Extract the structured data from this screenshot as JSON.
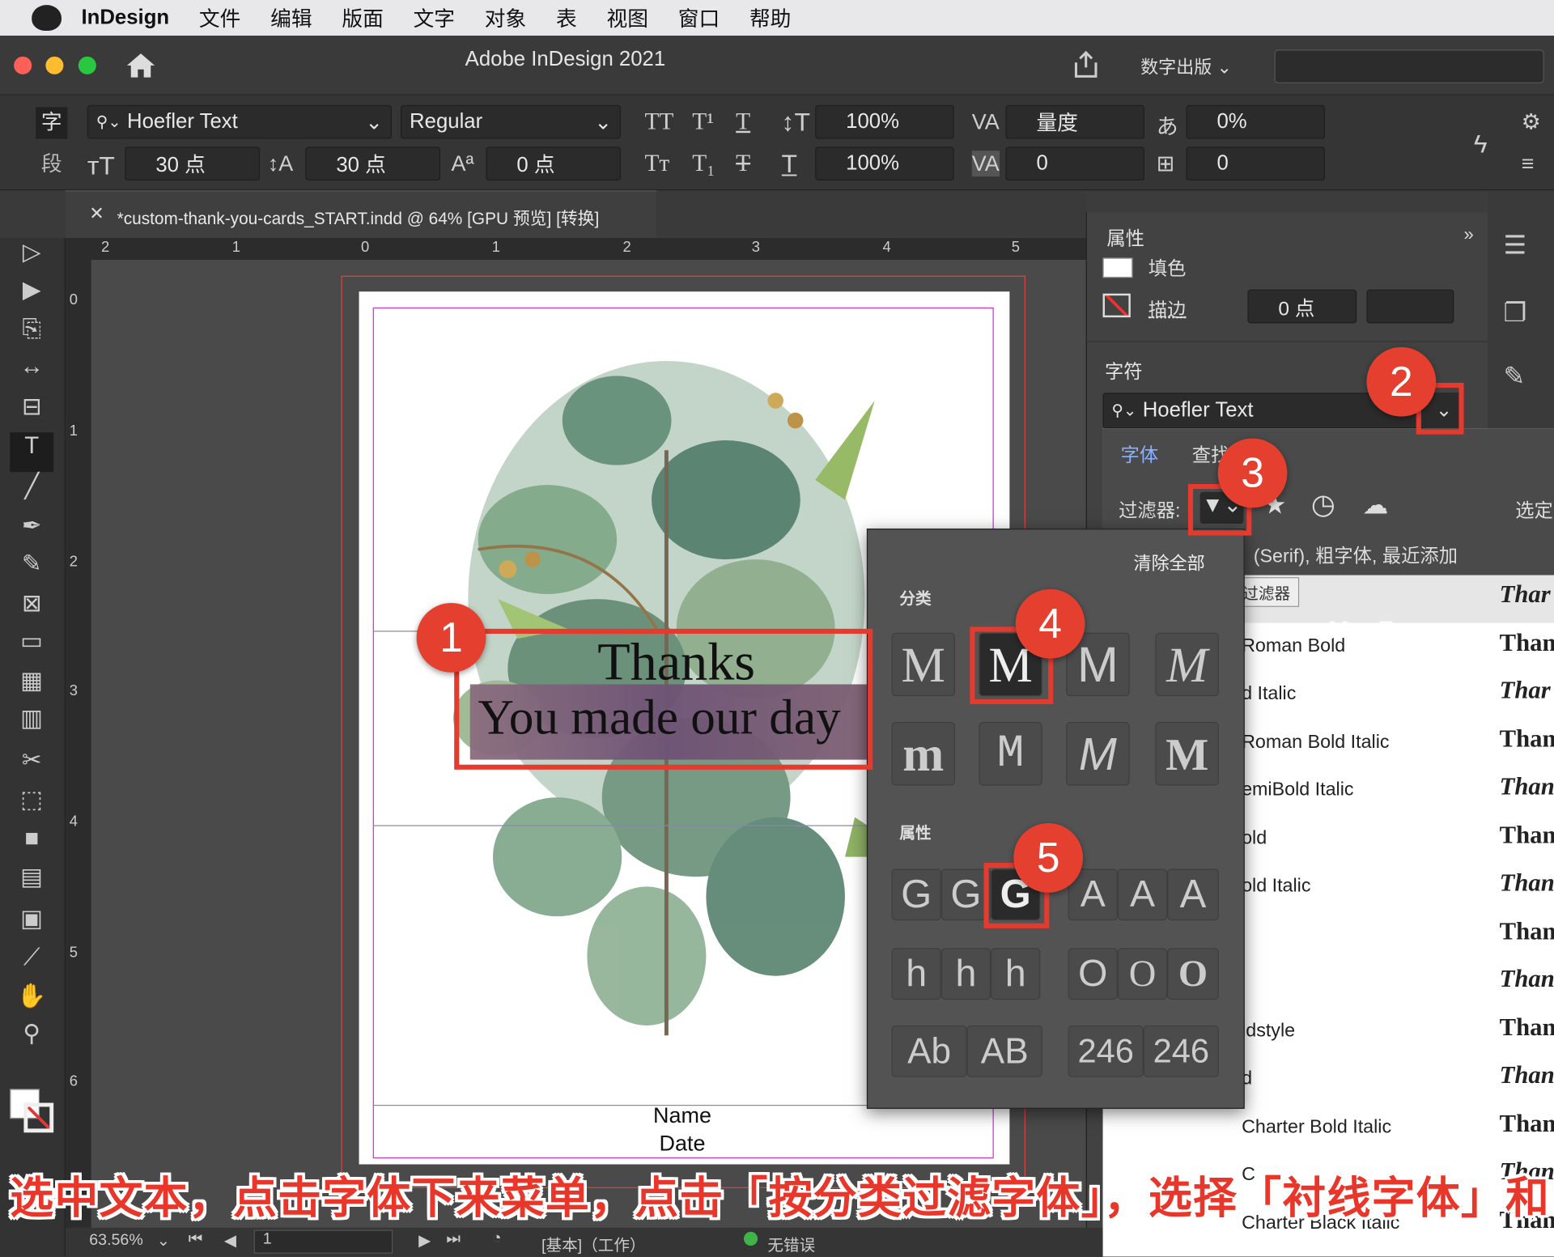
{
  "menubar": {
    "app": "InDesign",
    "items": [
      "文件",
      "编辑",
      "版面",
      "文字",
      "对象",
      "表",
      "视图",
      "窗口",
      "帮助"
    ]
  },
  "window": {
    "title": "Adobe InDesign 2021",
    "workspace": "数字出版"
  },
  "control": {
    "char_icon": "字",
    "para_icon": "段",
    "font": "Hoefler Text",
    "style": "Regular",
    "size": "30 点",
    "leading": "30 点",
    "baseline": "0 点",
    "vscale": "100%",
    "hscale": "100%",
    "kerning": "量度",
    "tracking": "0",
    "tsume": "0%",
    "grid": "0"
  },
  "doc_tab": {
    "title": "*custom-thank-you-cards_START.indd @ 64% [GPU 预览] [转换]"
  },
  "ruler_h": [
    "2",
    "1",
    "0",
    "1",
    "2",
    "3",
    "4",
    "5"
  ],
  "ruler_v": [
    "0",
    "1",
    "2",
    "3",
    "4",
    "5",
    "6"
  ],
  "card": {
    "line1": "Thanks",
    "line2": "You made our day",
    "name": "Name",
    "date": "Date"
  },
  "panel": {
    "title": "属性",
    "fill": "填色",
    "stroke": "描边",
    "stroke_weight": "0 点",
    "char_section": "字符",
    "font": "Hoefler Text"
  },
  "font_menu": {
    "tab_font": "字体",
    "tab_find": "查找",
    "filter_label": "过滤器:",
    "select": "选定",
    "applied": "(Serif), 粗字体, 最近添加",
    "tooltip": "清除过滤器",
    "watermark": "www.MacZ.com",
    "rows": [
      {
        "name": "",
        "sample": "Thar"
      },
      {
        "name": "Roman Bold",
        "sample": "Than"
      },
      {
        "name": "d Italic",
        "sample": "Thar"
      },
      {
        "name": "Roman Bold Italic",
        "sample": "Than"
      },
      {
        "name": "emiBold Italic",
        "sample": "Than"
      },
      {
        "name": "old",
        "sample": "Than"
      },
      {
        "name": "old Italic",
        "sample": "Than"
      },
      {
        "name": "",
        "sample": "Than"
      },
      {
        "name": "",
        "sample": "Thanl"
      },
      {
        "name": "ldstyle",
        "sample": "Thanl"
      },
      {
        "name": "d",
        "sample": "Than"
      },
      {
        "name": "Charter Bold Italic",
        "sample": "Than"
      },
      {
        "name": "C",
        "sample": "Than"
      },
      {
        "name": "Charter Black Italic",
        "sample": "Than"
      }
    ]
  },
  "filter_flyout": {
    "clear_all": "清除全部",
    "category": "分类",
    "properties": "属性",
    "class_glyphs": [
      "M",
      "M",
      "M",
      "M",
      "m",
      "M",
      "M",
      "M"
    ],
    "weight": [
      "G",
      "G",
      "G"
    ],
    "width": [
      "A",
      "A",
      "A"
    ],
    "xheight": [
      "h",
      "h",
      "h"
    ],
    "contrast": [
      "O",
      "O",
      "O"
    ],
    "case": [
      "Ab",
      "AB"
    ],
    "numerals": [
      "246",
      "246"
    ]
  },
  "badges": [
    "1",
    "2",
    "3",
    "4",
    "5"
  ],
  "status": {
    "zoom": "63.56%",
    "page": "1",
    "preset": "[基本]（工作）",
    "errors": "无错误"
  },
  "caption": "选中文本，点击字体下来菜单，点击「按分类过滤字体」，选择「衬线字体」和「粗字体」"
}
